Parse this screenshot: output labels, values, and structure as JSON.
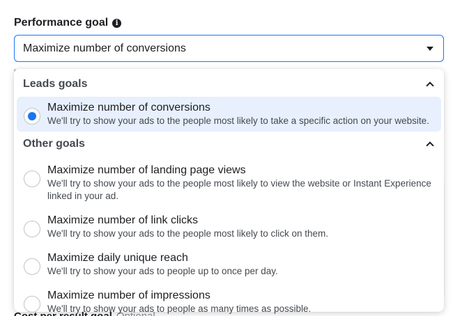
{
  "field": {
    "label": "Performance goal",
    "info_icon_glyph": "i",
    "selected_value": "Maximize number of conversions"
  },
  "background": {
    "footer_label": "Cost per result goal",
    "footer_optional": "Optional"
  },
  "dropdown": {
    "groups": [
      {
        "title": "Leads goals",
        "options": [
          {
            "title": "Maximize number of conversions",
            "description": "We'll try to show your ads to the people most likely to take a specific action on your website.",
            "selected": true
          }
        ]
      },
      {
        "title": "Other goals",
        "options": [
          {
            "title": "Maximize number of landing page views",
            "description": "We'll try to show your ads to the people most likely to view the website or Instant Experience linked in your ad.",
            "selected": false
          },
          {
            "title": "Maximize number of link clicks",
            "description": "We'll try to show your ads to the people most likely to click on them.",
            "selected": false
          },
          {
            "title": "Maximize daily unique reach",
            "description": "We'll try to show your ads to people up to once per day.",
            "selected": false
          },
          {
            "title": "Maximize number of impressions",
            "description": "We'll try to show your ads to people as many times as possible.",
            "selected": false
          }
        ]
      }
    ]
  },
  "colors": {
    "accent": "#1877f2",
    "selected_bg": "#e7f0fc"
  }
}
